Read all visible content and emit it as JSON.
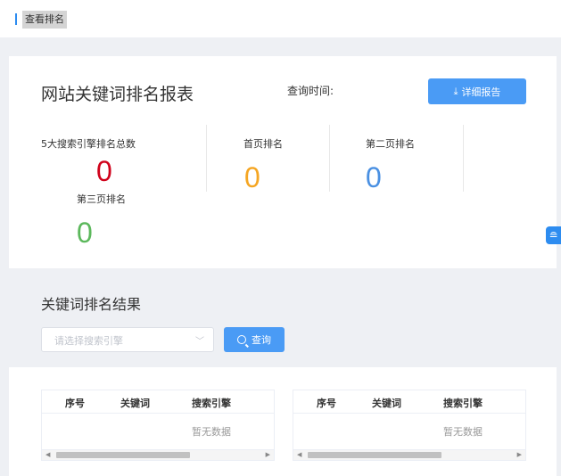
{
  "breadcrumb": {
    "label": "查看排名"
  },
  "report": {
    "title": "网站关键词排名报表",
    "query_time_label": "查询时间:",
    "detail_button": "详细报告",
    "stats": [
      {
        "label": "5大搜索引擎排名总数",
        "value": "0",
        "color": "#d0021b"
      },
      {
        "label": "首页排名",
        "value": "0",
        "color": "#f5a623"
      },
      {
        "label": "第二页排名",
        "value": "0",
        "color": "#4a90e2"
      },
      {
        "label": "第三页排名",
        "value": "0",
        "color": "#5cb85c"
      }
    ]
  },
  "results": {
    "title": "关键词排名结果",
    "engine_select": {
      "placeholder": "请选择搜索引擎"
    },
    "query_button": "查询",
    "tables": [
      {
        "headers": [
          "序号",
          "关键词",
          "搜索引擎"
        ],
        "empty_text": "暂无数据"
      },
      {
        "headers": [
          "序号",
          "关键词",
          "搜索引擎"
        ],
        "empty_text": "暂无数据"
      }
    ]
  },
  "colors": {
    "accent": "#4a9bf5"
  }
}
